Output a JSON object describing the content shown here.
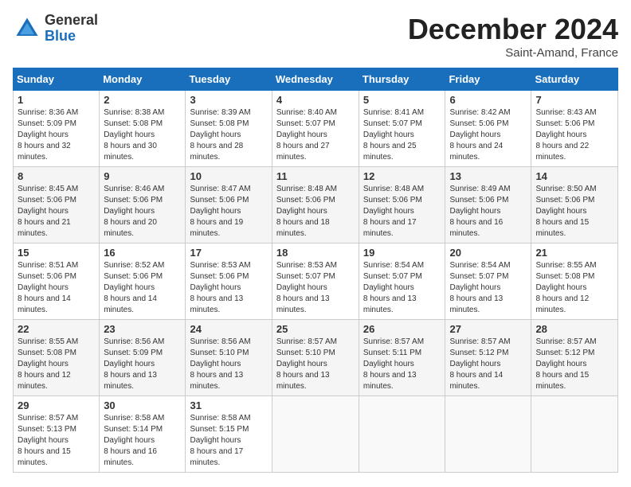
{
  "header": {
    "logo_general": "General",
    "logo_blue": "Blue",
    "month_title": "December 2024",
    "location": "Saint-Amand, France"
  },
  "days_of_week": [
    "Sunday",
    "Monday",
    "Tuesday",
    "Wednesday",
    "Thursday",
    "Friday",
    "Saturday"
  ],
  "weeks": [
    [
      {
        "day": "1",
        "sunrise": "8:36 AM",
        "sunset": "5:09 PM",
        "daylight": "8 hours and 32 minutes."
      },
      {
        "day": "2",
        "sunrise": "8:38 AM",
        "sunset": "5:08 PM",
        "daylight": "8 hours and 30 minutes."
      },
      {
        "day": "3",
        "sunrise": "8:39 AM",
        "sunset": "5:08 PM",
        "daylight": "8 hours and 28 minutes."
      },
      {
        "day": "4",
        "sunrise": "8:40 AM",
        "sunset": "5:07 PM",
        "daylight": "8 hours and 27 minutes."
      },
      {
        "day": "5",
        "sunrise": "8:41 AM",
        "sunset": "5:07 PM",
        "daylight": "8 hours and 25 minutes."
      },
      {
        "day": "6",
        "sunrise": "8:42 AM",
        "sunset": "5:06 PM",
        "daylight": "8 hours and 24 minutes."
      },
      {
        "day": "7",
        "sunrise": "8:43 AM",
        "sunset": "5:06 PM",
        "daylight": "8 hours and 22 minutes."
      }
    ],
    [
      {
        "day": "8",
        "sunrise": "8:45 AM",
        "sunset": "5:06 PM",
        "daylight": "8 hours and 21 minutes."
      },
      {
        "day": "9",
        "sunrise": "8:46 AM",
        "sunset": "5:06 PM",
        "daylight": "8 hours and 20 minutes."
      },
      {
        "day": "10",
        "sunrise": "8:47 AM",
        "sunset": "5:06 PM",
        "daylight": "8 hours and 19 minutes."
      },
      {
        "day": "11",
        "sunrise": "8:48 AM",
        "sunset": "5:06 PM",
        "daylight": "8 hours and 18 minutes."
      },
      {
        "day": "12",
        "sunrise": "8:48 AM",
        "sunset": "5:06 PM",
        "daylight": "8 hours and 17 minutes."
      },
      {
        "day": "13",
        "sunrise": "8:49 AM",
        "sunset": "5:06 PM",
        "daylight": "8 hours and 16 minutes."
      },
      {
        "day": "14",
        "sunrise": "8:50 AM",
        "sunset": "5:06 PM",
        "daylight": "8 hours and 15 minutes."
      }
    ],
    [
      {
        "day": "15",
        "sunrise": "8:51 AM",
        "sunset": "5:06 PM",
        "daylight": "8 hours and 14 minutes."
      },
      {
        "day": "16",
        "sunrise": "8:52 AM",
        "sunset": "5:06 PM",
        "daylight": "8 hours and 14 minutes."
      },
      {
        "day": "17",
        "sunrise": "8:53 AM",
        "sunset": "5:06 PM",
        "daylight": "8 hours and 13 minutes."
      },
      {
        "day": "18",
        "sunrise": "8:53 AM",
        "sunset": "5:07 PM",
        "daylight": "8 hours and 13 minutes."
      },
      {
        "day": "19",
        "sunrise": "8:54 AM",
        "sunset": "5:07 PM",
        "daylight": "8 hours and 13 minutes."
      },
      {
        "day": "20",
        "sunrise": "8:54 AM",
        "sunset": "5:07 PM",
        "daylight": "8 hours and 13 minutes."
      },
      {
        "day": "21",
        "sunrise": "8:55 AM",
        "sunset": "5:08 PM",
        "daylight": "8 hours and 12 minutes."
      }
    ],
    [
      {
        "day": "22",
        "sunrise": "8:55 AM",
        "sunset": "5:08 PM",
        "daylight": "8 hours and 12 minutes."
      },
      {
        "day": "23",
        "sunrise": "8:56 AM",
        "sunset": "5:09 PM",
        "daylight": "8 hours and 13 minutes."
      },
      {
        "day": "24",
        "sunrise": "8:56 AM",
        "sunset": "5:10 PM",
        "daylight": "8 hours and 13 minutes."
      },
      {
        "day": "25",
        "sunrise": "8:57 AM",
        "sunset": "5:10 PM",
        "daylight": "8 hours and 13 minutes."
      },
      {
        "day": "26",
        "sunrise": "8:57 AM",
        "sunset": "5:11 PM",
        "daylight": "8 hours and 13 minutes."
      },
      {
        "day": "27",
        "sunrise": "8:57 AM",
        "sunset": "5:12 PM",
        "daylight": "8 hours and 14 minutes."
      },
      {
        "day": "28",
        "sunrise": "8:57 AM",
        "sunset": "5:12 PM",
        "daylight": "8 hours and 15 minutes."
      }
    ],
    [
      {
        "day": "29",
        "sunrise": "8:57 AM",
        "sunset": "5:13 PM",
        "daylight": "8 hours and 15 minutes."
      },
      {
        "day": "30",
        "sunrise": "8:58 AM",
        "sunset": "5:14 PM",
        "daylight": "8 hours and 16 minutes."
      },
      {
        "day": "31",
        "sunrise": "8:58 AM",
        "sunset": "5:15 PM",
        "daylight": "8 hours and 17 minutes."
      },
      null,
      null,
      null,
      null
    ]
  ],
  "labels": {
    "sunrise": "Sunrise:",
    "sunset": "Sunset:",
    "daylight": "Daylight hours"
  }
}
